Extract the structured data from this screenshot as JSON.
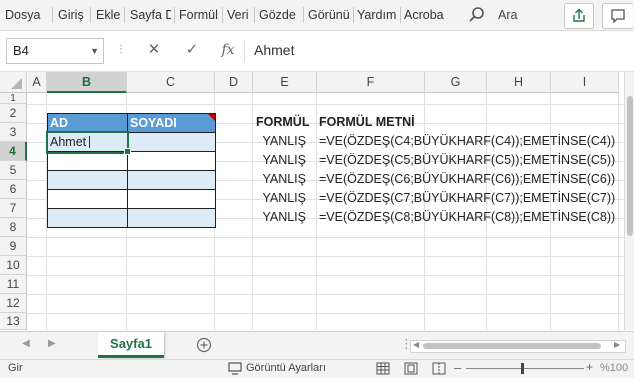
{
  "ribbon": {
    "tabs": [
      "Dosya",
      "Giriş",
      "Ekle",
      "Sayfa D",
      "Formül",
      "Veri",
      "Gözde",
      "Görünü",
      "Yardım",
      "Acroba"
    ],
    "search_label": "Ara"
  },
  "formula_bar": {
    "name_box": "B4",
    "fx_label": "fx",
    "formula": "Ahmet"
  },
  "columns": [
    "A",
    "B",
    "C",
    "D",
    "E",
    "F",
    "G",
    "H",
    "I"
  ],
  "rows": [
    "1",
    "2",
    "3",
    "4",
    "5",
    "6",
    "7",
    "8",
    "9",
    "10",
    "11",
    "12",
    "13"
  ],
  "table": {
    "headers": [
      "AD",
      "SOYADI"
    ],
    "active_cell_value": "Ahmet"
  },
  "results": {
    "header_formula": "FORMÜL",
    "header_text": "FORMÜL METNİ",
    "rows": [
      {
        "result": "YANLIŞ",
        "text": "=VE(ÖZDEŞ(C4;BÜYÜKHARF(C4));EMETİNSE(C4))"
      },
      {
        "result": "YANLIŞ",
        "text": "=VE(ÖZDEŞ(C5;BÜYÜKHARF(C5));EMETİNSE(C5))"
      },
      {
        "result": "YANLIŞ",
        "text": "=VE(ÖZDEŞ(C6;BÜYÜKHARF(C6));EMETİNSE(C6))"
      },
      {
        "result": "YANLIŞ",
        "text": "=VE(ÖZDEŞ(C7;BÜYÜKHARF(C7));EMETİNSE(C7))"
      },
      {
        "result": "YANLIŞ",
        "text": "=VE(ÖZDEŞ(C8;BÜYÜKHARF(C8));EMETİNSE(C8))"
      }
    ]
  },
  "sheet_tabs": [
    "Sayfa1"
  ],
  "status": {
    "mode": "Gir",
    "display_settings": "Görüntü Ayarları",
    "zoom": "%100"
  },
  "colors": {
    "accent": "#217346",
    "table_header": "#5b9bd5",
    "table_band": "#ddebf7"
  }
}
